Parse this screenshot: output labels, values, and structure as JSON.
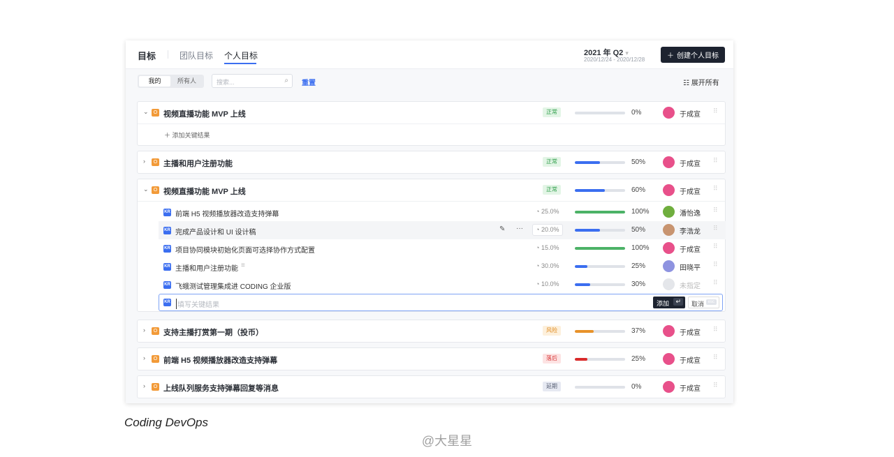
{
  "header": {
    "title": "目标",
    "tabs": [
      "团队目标",
      "个人目标"
    ],
    "quarter": "2021 年 Q2",
    "date_range": "2020/12/24 - 2020/12/28",
    "create_button": "创建个人目标"
  },
  "toolbar": {
    "segments": [
      "我的",
      "所有人"
    ],
    "search_placeholder": "搜索...",
    "reset": "重置",
    "expand_all": "展开所有"
  },
  "objectives": [
    {
      "title": "视频直播功能 MVP 上线",
      "status": "正常",
      "progress": 0,
      "pct": "0%",
      "owner": "于成宣",
      "expanded": true,
      "add_kr": "添加关键结果"
    },
    {
      "title": "主播和用户注册功能",
      "status": "正常",
      "progress": 50,
      "pct": "50%",
      "owner": "于成宣"
    },
    {
      "title": "视频直播功能 MVP 上线",
      "status": "正常",
      "progress": 60,
      "pct": "60%",
      "owner": "于成宣",
      "expanded": true
    },
    {
      "title": "支持主播打赏第一期（投币）",
      "status": "风险",
      "progress": 37,
      "pct": "37%",
      "owner": "于成宣"
    },
    {
      "title": "前端 H5 视频播放器改造支持弹幕",
      "status": "落后",
      "progress": 25,
      "pct": "25%",
      "owner": "于成宣"
    },
    {
      "title": "上线队列服务支持弹幕回复等消息",
      "status": "延期",
      "progress": 0,
      "pct": "0%",
      "owner": "于成宣"
    }
  ],
  "key_results": [
    {
      "title": "前端 H5 视频播放器改造支持弹幕",
      "weight": "25.0%",
      "progress": 100,
      "pct": "100%",
      "owner": "潘怡逸"
    },
    {
      "title": "完成产品设计和 UI 设计稿",
      "weight": "20.0%",
      "progress": 50,
      "pct": "50%",
      "owner": "李浩龙"
    },
    {
      "title": "项目协同模块初始化页面可选择协作方式配置",
      "weight": "15.0%",
      "progress": 100,
      "pct": "100%",
      "owner": "于成宣"
    },
    {
      "title": "主播和用户注册功能",
      "weight": "30.0%",
      "progress": 25,
      "pct": "25%",
      "owner": "田晓平"
    },
    {
      "title": "飞蛾测试管理集成进 CODING 企业版",
      "weight": "10.0%",
      "progress": 30,
      "pct": "30%",
      "owner": "未指定"
    }
  ],
  "kr_input": {
    "placeholder": "填写关键结果",
    "add": "添加",
    "cancel": "取消",
    "esc": "esc",
    "kr_tag": "KR"
  },
  "caption": "Coding DevOps",
  "watermark": "@大星星",
  "colors": {
    "正常": [
      "#e3f5e6",
      "#2f9e4b"
    ],
    "风险": [
      "#fdf0dc",
      "#e08a1e"
    ],
    "落后": [
      "#fde3e3",
      "#d83a3a"
    ],
    "延期": [
      "#e6e9f2",
      "#5a6276"
    ],
    "blue": "#3b6ef0",
    "green": "#4cb267",
    "orange": "#e8922a",
    "red": "#d92b2b"
  }
}
